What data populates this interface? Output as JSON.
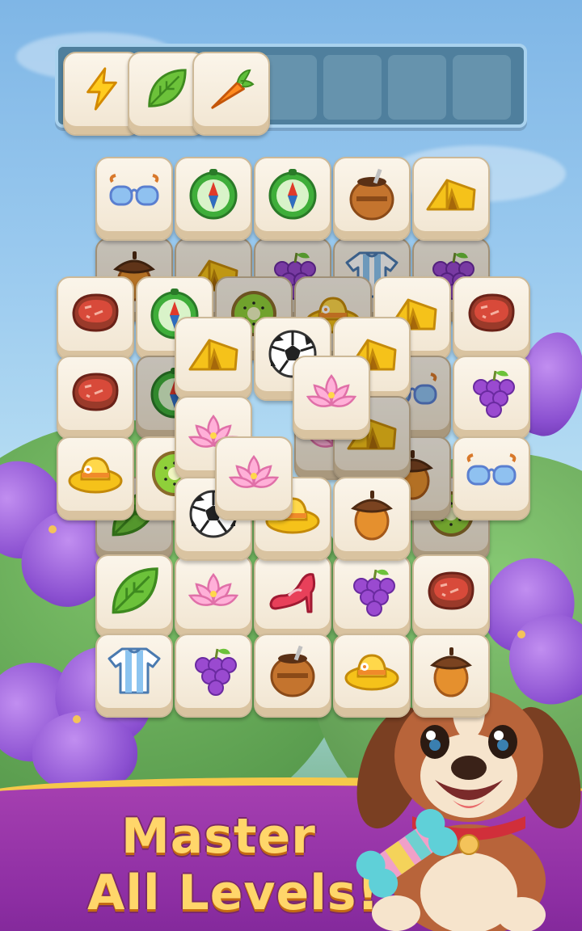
{
  "tray": {
    "slots_total": 7,
    "items": [
      {
        "icon": "lightning-icon"
      },
      {
        "icon": "leaf-icon"
      },
      {
        "icon": "carrot-icon"
      }
    ]
  },
  "board": {
    "tiles": [
      {
        "icon": "sunglasses-icon"
      },
      {
        "icon": "compass-icon"
      },
      {
        "icon": "compass-icon"
      },
      {
        "icon": "mate-cup-icon"
      },
      {
        "icon": "tent-icon"
      },
      {
        "icon": "acorn-icon"
      },
      {
        "icon": "tent-icon"
      },
      {
        "icon": "grapes-icon"
      },
      {
        "icon": "jersey-icon"
      },
      {
        "icon": "grapes-icon"
      },
      {
        "icon": "steak-icon"
      },
      {
        "icon": "compass-icon"
      },
      {
        "icon": "kiwi-icon"
      },
      {
        "icon": "sun-hat-icon"
      },
      {
        "icon": "tent-icon"
      },
      {
        "icon": "steak-icon"
      },
      {
        "icon": "steak-icon"
      },
      {
        "icon": "compass-icon"
      },
      {
        "icon": "sunglasses-icon"
      },
      {
        "icon": "grapes-icon"
      },
      {
        "icon": "sun-hat-icon"
      },
      {
        "icon": "kiwi-icon"
      },
      {
        "icon": "acorn-icon"
      },
      {
        "icon": "sunglasses-icon"
      },
      {
        "icon": "tent-icon"
      },
      {
        "icon": "soccer-ball-icon"
      },
      {
        "icon": "tent-icon"
      },
      {
        "icon": "lotus-icon"
      },
      {
        "icon": "lotus-icon"
      },
      {
        "icon": "tent-icon"
      },
      {
        "icon": "leaf-icon"
      },
      {
        "icon": "soccer-ball-icon"
      },
      {
        "icon": "sun-hat-icon"
      },
      {
        "icon": "acorn-icon"
      },
      {
        "icon": "kiwi-icon"
      },
      {
        "icon": "lotus-icon"
      },
      {
        "icon": "leaf-icon"
      },
      {
        "icon": "lotus-icon"
      },
      {
        "icon": "high-heel-icon"
      },
      {
        "icon": "grapes-icon"
      },
      {
        "icon": "steak-icon"
      },
      {
        "icon": "jersey-icon"
      },
      {
        "icon": "grapes-icon"
      },
      {
        "icon": "mate-cup-icon"
      },
      {
        "icon": "sun-hat-icon"
      },
      {
        "icon": "acorn-icon"
      }
    ]
  },
  "banner": {
    "line1": "Master",
    "line2": "All Levels!"
  },
  "mascot": {
    "icon": "puppy-with-bone-icon"
  },
  "colors": {
    "banner_bg": "#8d2ea3",
    "banner_border": "#f6c84a",
    "slogan_text": "#ffd66a",
    "tray_bg": "#4f7f9d",
    "tile_face": "#fbf5ea"
  }
}
